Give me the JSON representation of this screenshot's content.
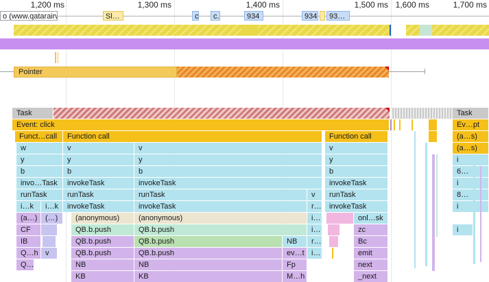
{
  "ruler": {
    "ticks": [
      "1,200 ms",
      "1,300 ms",
      "1,400 ms",
      "1,500 ms",
      "1,600 ms",
      "1,700 ms"
    ]
  },
  "network": {
    "items": [
      "o (www.qatarairwa",
      "Sl…",
      "c",
      "c.",
      "934",
      "934",
      "93…"
    ]
  },
  "tracks": {
    "pointer_label": "Pointer"
  },
  "flame": {
    "row0": [
      "Task",
      "Task"
    ],
    "row1": [
      "Event: click",
      "Ev…pt"
    ],
    "row2": [
      "Funct…call",
      "Function call",
      "Function call",
      "(a…s)"
    ],
    "row3": [
      "w",
      "v",
      "v",
      "v",
      "(a…s)"
    ],
    "row4": [
      "y",
      "y",
      "y",
      "y",
      "i"
    ],
    "row5": [
      "b",
      "b",
      "b",
      "b",
      "6…"
    ],
    "row6": [
      "invo…Task",
      "invokeTask",
      "invokeTask",
      "invokeTask",
      "i"
    ],
    "row7": [
      "runTask",
      "runTask",
      "runTask",
      "v",
      "runTask",
      "8…"
    ],
    "row8": [
      "i…k",
      "i…k",
      "invokeTask",
      "invokeTask",
      "r…",
      "invokeTask",
      "i"
    ],
    "row9": [
      "(a…)",
      "(…)",
      "(anonymous)",
      "(anonymous)",
      "i…",
      "onl…sk"
    ],
    "row10": [
      "CF",
      "(…)",
      "QB.b.push",
      "QB.b.push",
      "i…",
      "zc",
      "i"
    ],
    "row11": [
      "IB",
      "QB.b.push",
      "QB.b.push",
      "NB",
      "r…",
      "Bc"
    ],
    "row12": [
      "Q…h",
      "v",
      "QB.b.push",
      "QB.b.push",
      "ev…t",
      "i…",
      "emit"
    ],
    "row13": [
      "Q…",
      "NB",
      "NB",
      "Fp",
      "next"
    ],
    "row14": [
      "KB",
      "KB",
      "M…h",
      "_next"
    ]
  }
}
